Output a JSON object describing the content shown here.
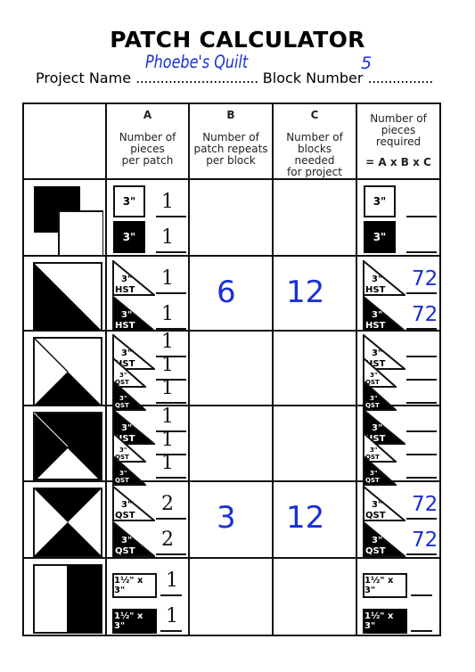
{
  "title": "PATCH CALCULATOR",
  "project_name_label": "Project Name",
  "project_name_dots": "..............................",
  "project_name_value": "Phoebe's Quilt",
  "block_number_label": "Block Number",
  "block_number_dots": "................",
  "block_number_value": "5",
  "colors": {
    "handwriting_blue": "#1a2fd6",
    "ink": "#111111"
  },
  "headers": {
    "a": {
      "letter": "A",
      "desc": [
        "Number of",
        "pieces",
        "per patch"
      ]
    },
    "b": {
      "letter": "B",
      "desc": [
        "Number of",
        "patch repeats",
        "per block"
      ]
    },
    "c": {
      "letter": "C",
      "desc": [
        "Number of",
        "blocks",
        "needed",
        "for project"
      ]
    },
    "total": {
      "desc": [
        "Number of",
        "pieces",
        "required"
      ],
      "formula": "= A x B x C"
    }
  },
  "rows": [
    {
      "block": "overlapping-squares",
      "pieces": [
        {
          "shape": "square",
          "color": "white",
          "label": "3\"",
          "a": "1",
          "total": ""
        },
        {
          "shape": "square",
          "color": "black",
          "label": "3\"",
          "a": "1",
          "total": ""
        }
      ],
      "b": "",
      "c": ""
    },
    {
      "block": "half-square-triangle",
      "pieces": [
        {
          "shape": "triangle",
          "color": "white",
          "size": "3\"",
          "type": "HST",
          "a": "1",
          "total": "72"
        },
        {
          "shape": "triangle",
          "color": "black",
          "size": "3\"",
          "type": "HST",
          "a": "1",
          "total": "72"
        }
      ],
      "b": "6",
      "c": "12"
    },
    {
      "block": "hst-qst-white-top",
      "pieces": [
        {
          "shape": "triangle",
          "color": "white",
          "size": "3\"",
          "type": "HST",
          "a": "1",
          "total": ""
        },
        {
          "shape": "triangle",
          "color": "white",
          "size": "3\"",
          "type": "QST",
          "a": "1",
          "total": ""
        },
        {
          "shape": "triangle",
          "color": "black",
          "size": "3\"",
          "type": "QST",
          "a": "1",
          "total": ""
        }
      ],
      "b": "",
      "c": ""
    },
    {
      "block": "hst-qst-black-top",
      "pieces": [
        {
          "shape": "triangle",
          "color": "black",
          "size": "3\"",
          "type": "HST",
          "a": "1",
          "total": ""
        },
        {
          "shape": "triangle",
          "color": "white",
          "size": "3\"",
          "type": "QST",
          "a": "1",
          "total": ""
        },
        {
          "shape": "triangle",
          "color": "black",
          "size": "3\"",
          "type": "QST",
          "a": "1",
          "total": ""
        }
      ],
      "b": "",
      "c": ""
    },
    {
      "block": "quarter-square-triangle",
      "pieces": [
        {
          "shape": "triangle",
          "color": "white",
          "size": "3\"",
          "type": "QST",
          "a": "2",
          "total": "72"
        },
        {
          "shape": "triangle",
          "color": "black",
          "size": "3\"",
          "type": "QST",
          "a": "2",
          "total": "72"
        }
      ],
      "b": "3",
      "c": "12"
    },
    {
      "block": "two-rectangles",
      "pieces": [
        {
          "shape": "rect",
          "color": "white",
          "label": "1½\" x 3\"",
          "a": "1",
          "total": ""
        },
        {
          "shape": "rect",
          "color": "black",
          "label": "1½\" x 3\"",
          "a": "1",
          "total": ""
        }
      ],
      "b": "",
      "c": ""
    }
  ]
}
